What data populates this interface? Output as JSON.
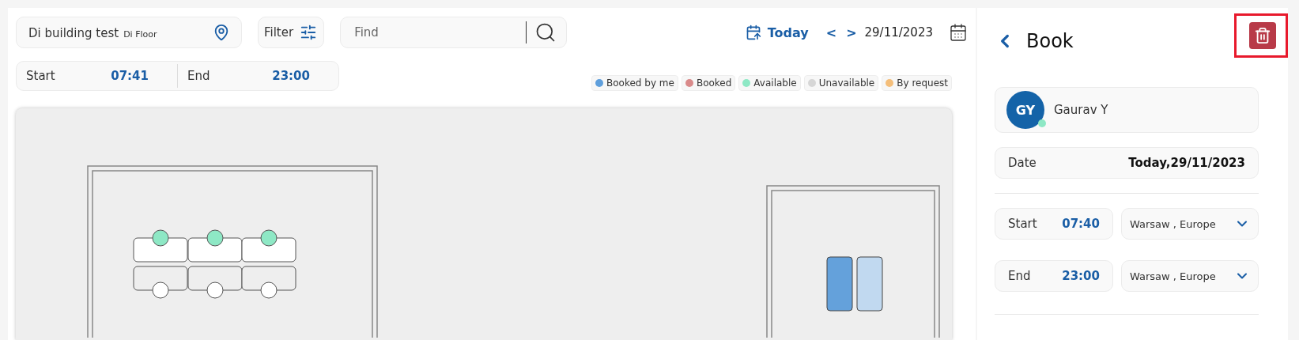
{
  "location": {
    "building": "Di building test",
    "floor": "Di Floor"
  },
  "filter": {
    "label": "Filter"
  },
  "search": {
    "placeholder": "Find"
  },
  "date_nav": {
    "today": "Today",
    "prev": "<",
    "next": ">",
    "date": "29/11/2023"
  },
  "time_range": [
    {
      "label": "Start",
      "value": "07:41"
    },
    {
      "label": "End",
      "value": "23:00"
    }
  ],
  "legend": [
    {
      "label": "Booked by me",
      "color": "#5f9fdc"
    },
    {
      "label": "Booked",
      "color": "#d98a8a"
    },
    {
      "label": "Available",
      "color": "#8ee8c5"
    },
    {
      "label": "Unavailable",
      "color": "#d6d6d6"
    },
    {
      "label": "By request",
      "color": "#f4be7a"
    }
  ],
  "floor_plan": {
    "top_desks": [
      {
        "color": "#8ee8c5"
      },
      {
        "color": "#8ee8c5"
      },
      {
        "color": "#8ee8c5"
      }
    ],
    "bottom_desks": [
      {
        "color": "#ffffff"
      },
      {
        "color": "#ffffff"
      },
      {
        "color": "#ffffff"
      }
    ],
    "pods": [
      {
        "color": "#64a1db"
      },
      {
        "color": "#c1d9f0"
      }
    ]
  },
  "booking": {
    "title": "Book",
    "user": {
      "initials": "GY",
      "name": "Gaurav Y",
      "online": true
    },
    "date": {
      "label": "Date",
      "value": "Today,29/11/2023"
    },
    "times": [
      {
        "label": "Start",
        "value": "07:40",
        "timezone": "Warsaw , Europe"
      },
      {
        "label": "End",
        "value": "23:00",
        "timezone": "Warsaw , Europe"
      }
    ],
    "delete_highlighted": true
  }
}
